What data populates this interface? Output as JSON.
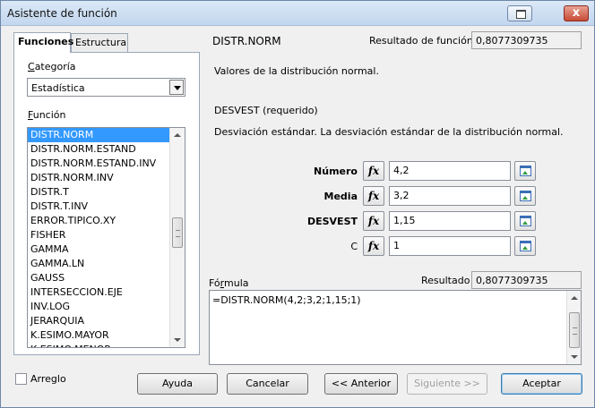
{
  "window": {
    "title": "Asistente de función",
    "restore_icon": "restore-icon",
    "close_label": "x"
  },
  "tabs": [
    {
      "label": "Funciones",
      "active": true
    },
    {
      "label": "Estructura",
      "active": false
    }
  ],
  "category": {
    "label_accesskey": "C",
    "label_rest": "ategoría",
    "selected": "Estadística"
  },
  "function_list": {
    "label_accesskey": "F",
    "label_rest": "unción",
    "selected_index": 0,
    "items": [
      "DISTR.NORM",
      "DISTR.NORM.ESTAND",
      "DISTR.NORM.ESTAND.INV",
      "DISTR.NORM.INV",
      "DISTR.T",
      "DISTR.T.INV",
      "ERROR.TIPICO.XY",
      "FISHER",
      "GAMMA",
      "GAMMA.LN",
      "GAUSS",
      "INTERSECCION.EJE",
      "INV.LOG",
      "JERARQUIA",
      "K.ESIMO.MAYOR",
      "K.ESIMO.MENOR"
    ],
    "scroll_position": 0.47
  },
  "function_info": {
    "name": "DISTR.NORM",
    "result_label": "Resultado de función",
    "result_value": "0,8077309735",
    "description": "Valores de la distribución normal.",
    "param_title": "DESVEST (requerido)",
    "param_description": "Desviación estándar. La desviación estándar de la distribución normal."
  },
  "arguments": [
    {
      "label": "Número",
      "value": "4,2",
      "bold": true
    },
    {
      "label": "Media",
      "value": "3,2",
      "bold": true
    },
    {
      "label": "DESVEST",
      "value": "1,15",
      "bold": true
    },
    {
      "label": "C",
      "value": "1",
      "bold": false
    }
  ],
  "fx_label": "fx",
  "formula": {
    "label_accesskey": "r",
    "label_before": "Fó",
    "label_after": "mula",
    "result_label": "Resultado",
    "result_value": "0,8077309735",
    "text": "=DISTR.NORM(4,2;3,2;1,15;1)"
  },
  "array_checkbox": {
    "label": "Arreglo",
    "checked": false
  },
  "buttons": {
    "help": "Ayuda",
    "cancel": "Cancelar",
    "previous": "<< Anterior",
    "next": "Siguiente >>",
    "accept": "Aceptar"
  }
}
